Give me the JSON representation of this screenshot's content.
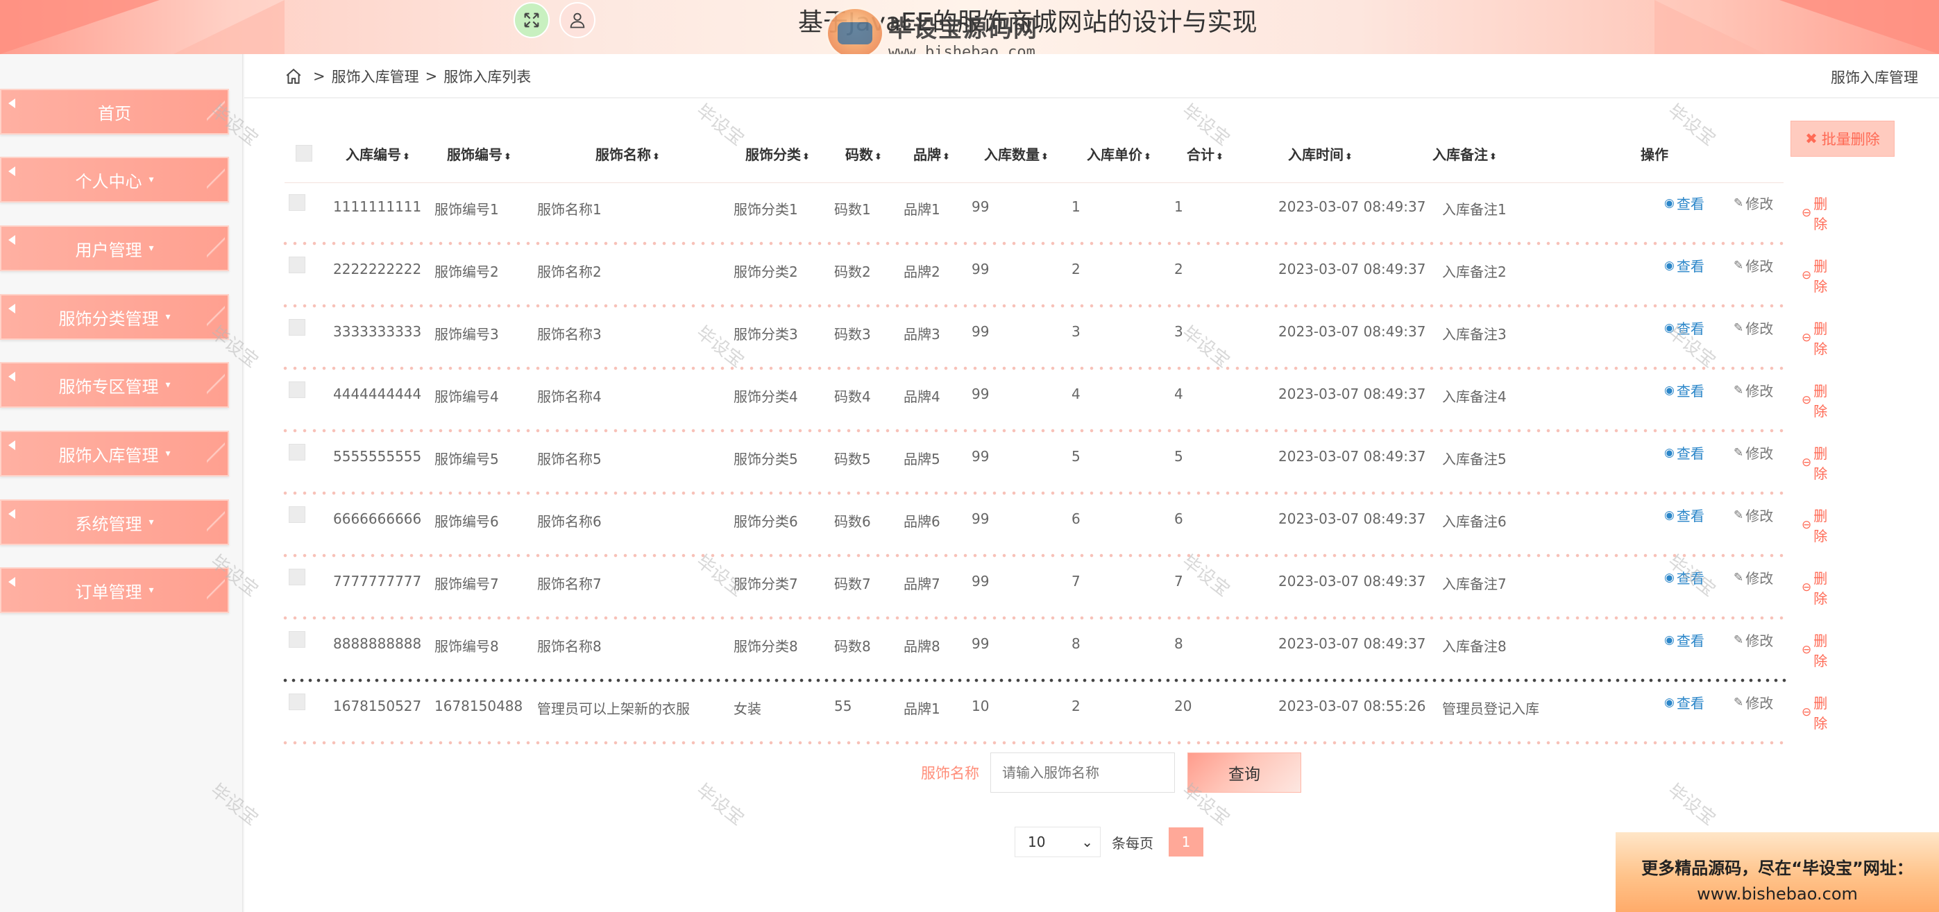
{
  "header": {
    "site_title": "基于JavaEE的服饰商城网站的设计与实现",
    "logo_name": "毕设宝源码网",
    "logo_url": "www.bishebao.com",
    "fullscreen_icon": "expand-icon",
    "user_icon": "user-icon"
  },
  "sidebar": {
    "items": [
      {
        "label": "首页",
        "has_caret": false
      },
      {
        "label": "个人中心",
        "has_caret": true
      },
      {
        "label": "用户管理",
        "has_caret": true
      },
      {
        "label": "服饰分类管理",
        "has_caret": true
      },
      {
        "label": "服饰专区管理",
        "has_caret": true
      },
      {
        "label": "服饰入库管理",
        "has_caret": true
      },
      {
        "label": "系统管理",
        "has_caret": true
      },
      {
        "label": "订单管理",
        "has_caret": true
      }
    ],
    "caret": "▾"
  },
  "breadcrumb": {
    "home_icon": "home-icon",
    "sep": ">",
    "level1": "服饰入库管理",
    "level2": "服饰入库列表",
    "right": "服饰入库管理"
  },
  "toolbar": {
    "batch_delete_icon": "✖",
    "batch_delete_label": "批量删除"
  },
  "table": {
    "sort_glyph": "⬍",
    "columns": [
      "入库编号",
      "服饰编号",
      "服饰名称",
      "服饰分类",
      "码数",
      "品牌",
      "入库数量",
      "入库单价",
      "合计",
      "入库时间",
      "入库备注",
      "操作"
    ],
    "actions": {
      "view": "查看",
      "edit": "修改",
      "delete": "删除",
      "view_icon": "◉",
      "edit_icon": "✎",
      "delete_icon": "⊖"
    },
    "rows": [
      [
        "1111111111",
        "服饰编号1",
        "服饰名称1",
        "服饰分类1",
        "码数1",
        "品牌1",
        "99",
        "1",
        "1",
        "2023-03-07 08:49:37",
        "入库备注1"
      ],
      [
        "2222222222",
        "服饰编号2",
        "服饰名称2",
        "服饰分类2",
        "码数2",
        "品牌2",
        "99",
        "2",
        "2",
        "2023-03-07 08:49:37",
        "入库备注2"
      ],
      [
        "3333333333",
        "服饰编号3",
        "服饰名称3",
        "服饰分类3",
        "码数3",
        "品牌3",
        "99",
        "3",
        "3",
        "2023-03-07 08:49:37",
        "入库备注3"
      ],
      [
        "4444444444",
        "服饰编号4",
        "服饰名称4",
        "服饰分类4",
        "码数4",
        "品牌4",
        "99",
        "4",
        "4",
        "2023-03-07 08:49:37",
        "入库备注4"
      ],
      [
        "5555555555",
        "服饰编号5",
        "服饰名称5",
        "服饰分类5",
        "码数5",
        "品牌5",
        "99",
        "5",
        "5",
        "2023-03-07 08:49:37",
        "入库备注5"
      ],
      [
        "6666666666",
        "服饰编号6",
        "服饰名称6",
        "服饰分类6",
        "码数6",
        "品牌6",
        "99",
        "6",
        "6",
        "2023-03-07 08:49:37",
        "入库备注6"
      ],
      [
        "7777777777",
        "服饰编号7",
        "服饰名称7",
        "服饰分类7",
        "码数7",
        "品牌7",
        "99",
        "7",
        "7",
        "2023-03-07 08:49:37",
        "入库备注7"
      ],
      [
        "8888888888",
        "服饰编号8",
        "服饰名称8",
        "服饰分类8",
        "码数8",
        "品牌8",
        "99",
        "8",
        "8",
        "2023-03-07 08:49:37",
        "入库备注8"
      ],
      [
        "1678150527",
        "1678150488",
        "管理员可以上架新的衣服",
        "女装",
        "55",
        "品牌1",
        "10",
        "2",
        "20",
        "2023-03-07 08:55:26",
        "管理员登记入库"
      ]
    ]
  },
  "search": {
    "label": "服饰名称",
    "placeholder": "请输入服饰名称",
    "button": "查询"
  },
  "pagination": {
    "page_size": "10",
    "per_page_label": "条每页",
    "current_page": "1"
  },
  "watermark": "毕设宝",
  "ad": {
    "line1": "更多精品源码，尽在“毕设宝”网址：",
    "line2": "www.bishebao.com"
  },
  "colors": {
    "accent": "#ffa090",
    "delete": "#ff6a55",
    "view": "#2b86c9"
  }
}
